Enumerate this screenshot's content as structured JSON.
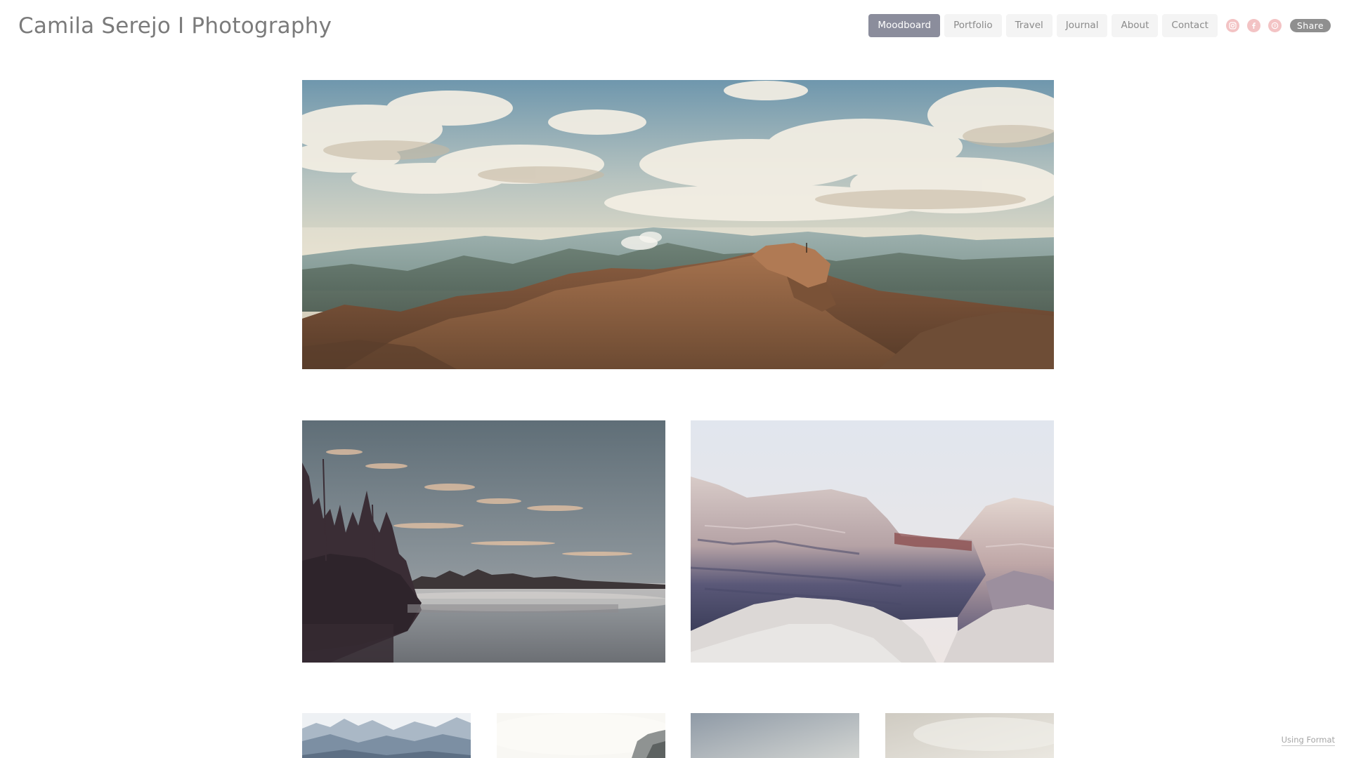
{
  "site": {
    "title": "Camila Serejo I Photography"
  },
  "nav": {
    "items": [
      {
        "label": "Moodboard",
        "active": true
      },
      {
        "label": "Portfolio",
        "active": false
      },
      {
        "label": "Travel",
        "active": false
      },
      {
        "label": "Journal",
        "active": false
      },
      {
        "label": "About",
        "active": false
      },
      {
        "label": "Contact",
        "active": false
      }
    ],
    "social_icons": [
      "instagram-icon",
      "facebook-icon",
      "pinterest-icon"
    ],
    "share_label": "Share"
  },
  "gallery": {
    "images": [
      "mountain-ridge-panorama",
      "misty-lake-forest",
      "painted-badlands",
      "snowy-mountains",
      "misty-cliff",
      "hazy-sky",
      "pale-sky"
    ]
  },
  "footer": {
    "using_format_label": "Using Format"
  },
  "colors": {
    "nav_active_bg": "#8b8d9c",
    "nav_bg": "#f4f4f4",
    "social_icon_bg": "#f3c3c4",
    "share_bg": "#8f8f8f",
    "title_text": "#7b7b7b"
  }
}
